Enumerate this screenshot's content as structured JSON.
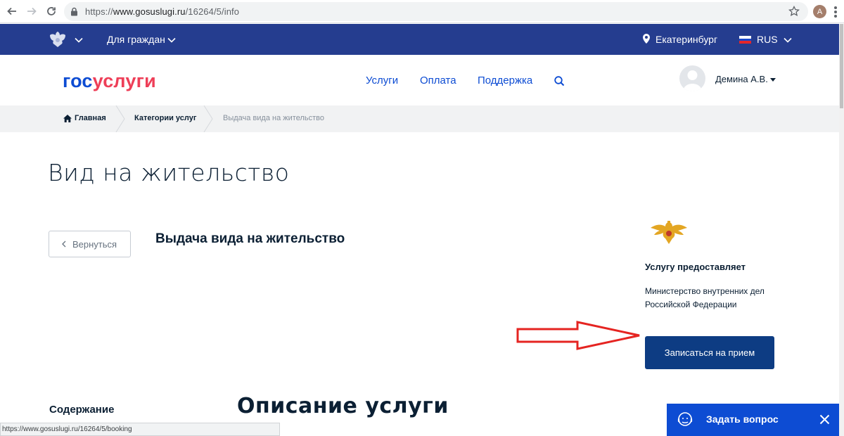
{
  "browser": {
    "url_prefix": "https://",
    "url_host": "www.gosuslugi.ru",
    "url_path": "/16264/5/info",
    "profile_initial": "A"
  },
  "topbar": {
    "citizens_label": "Для граждан",
    "city": "Екатеринбург",
    "language": "RUS"
  },
  "header": {
    "logo_part1": "гос",
    "logo_part2": "услуги",
    "nav": [
      "Услуги",
      "Оплата",
      "Поддержка"
    ],
    "user_name": "Демина А.В."
  },
  "breadcrumb": {
    "home": "Главная",
    "categories": "Категории услуг",
    "current": "Выдача вида на жительство"
  },
  "main": {
    "page_title": "Вид на жительство",
    "back_label": "Вернуться",
    "service_title": "Выдача вида на жительство",
    "provider_label": "Услугу предоставляет",
    "provider_name": "Министерство внутренних дел Российской Федерации",
    "booking_label": "Записаться на прием",
    "contents_label": "Содержание",
    "description_title": "Описание услуги"
  },
  "status_bar": {
    "hover_url": "https://www.gosuslugi.ru/16264/5/booking"
  },
  "chat": {
    "label": "Задать вопрос"
  },
  "colors": {
    "topbar_bg": "#253d8f",
    "logo_blue": "#0d4cd3",
    "logo_red": "#ee3f58",
    "booking_bg": "#0d3c83",
    "chat_bg": "#0d4cd3",
    "arrow_red": "#e52421"
  }
}
